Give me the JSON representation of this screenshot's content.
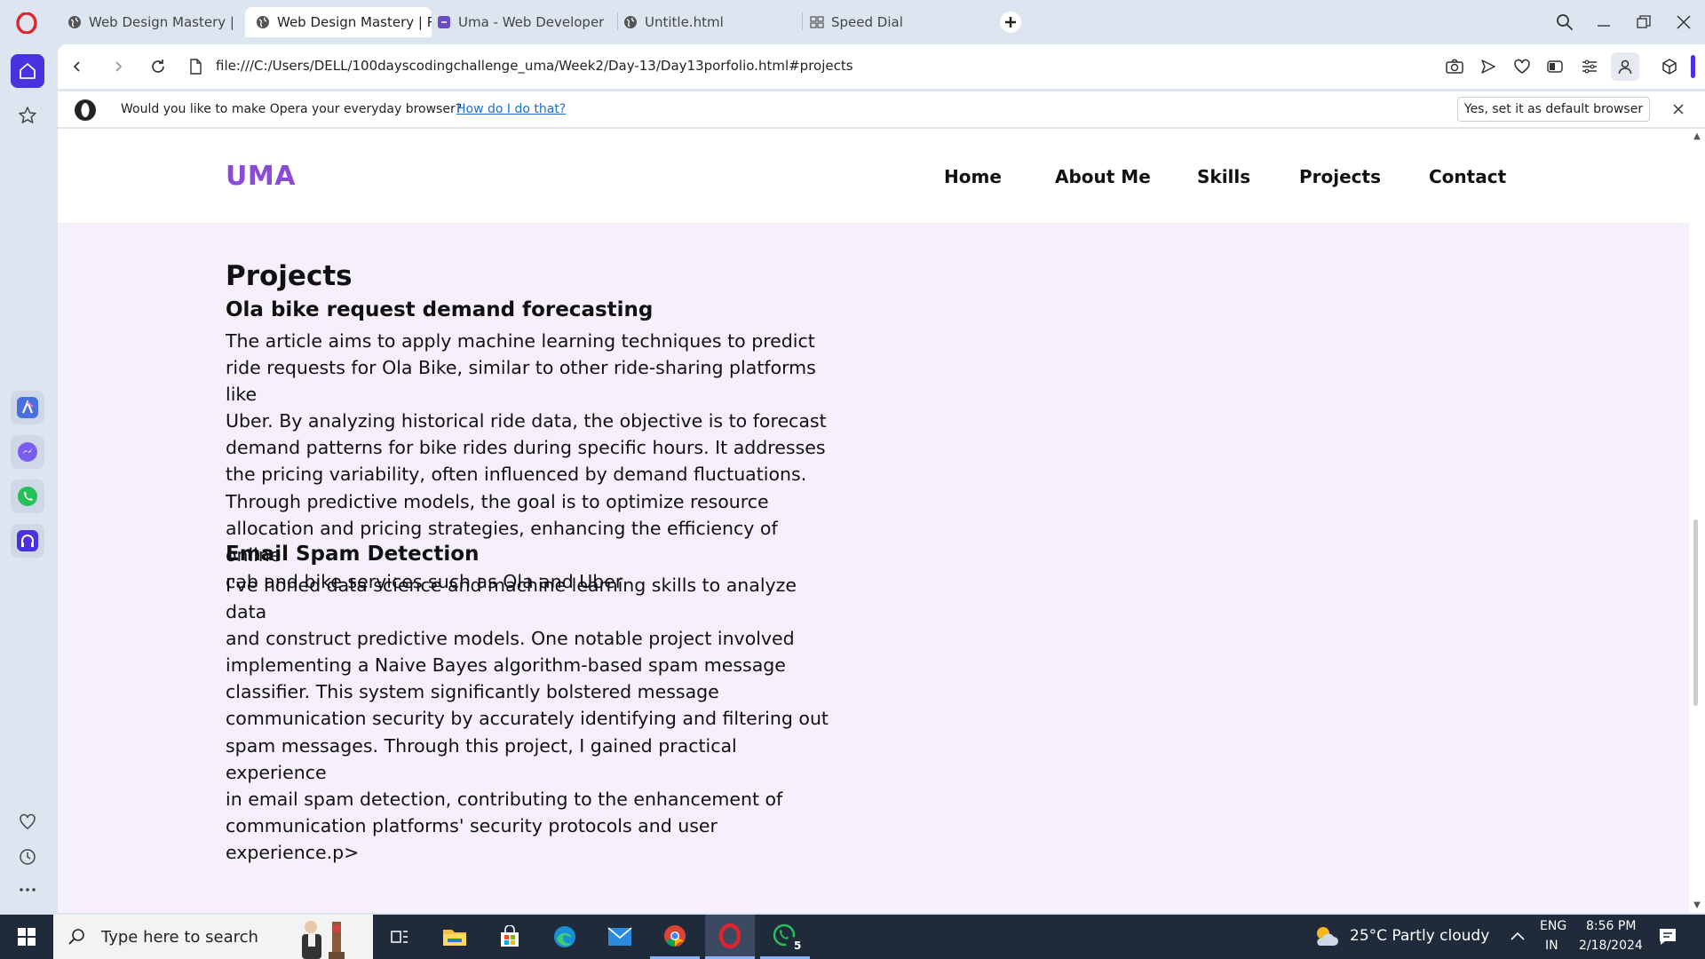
{
  "browser": {
    "tabs": [
      {
        "label": "Web Design Mastery | Res",
        "active": false
      },
      {
        "label": "Web Design Mastery | Res",
        "active": true
      },
      {
        "label": "Uma - Web Developer",
        "active": false
      },
      {
        "label": "Untitle.html",
        "active": false
      },
      {
        "label": "Speed Dial",
        "active": false
      }
    ],
    "url": "file:///C:/Users/DELL/100dayscodingchallenge_uma/Week2/Day-13/Day13porfolio.html#projects",
    "infobar": {
      "message": "Would you like to make Opera your everyday browser?",
      "link": "How do I do that?",
      "button": "Yes, set it as default browser"
    }
  },
  "site": {
    "logo": "UMA",
    "nav": [
      "Home",
      "About Me",
      "Skills",
      "Projects",
      "Contact"
    ],
    "section_title": "Projects",
    "projects": [
      {
        "title": "Ola bike request demand forecasting",
        "lines": [
          "The article aims to apply machine learning techniques to predict",
          "ride requests for Ola Bike, similar to other ride-sharing platforms like",
          "Uber. By analyzing historical ride data, the objective is to forecast",
          "demand patterns for bike rides during specific hours. It addresses",
          "the pricing variability, often influenced by demand fluctuations.",
          "Through predictive models, the goal is to optimize resource",
          "allocation and pricing strategies, enhancing the efficiency of online",
          "cab and bike services such as Ola and Uber"
        ]
      },
      {
        "title": "Email Spam Detection",
        "lines": [
          "I've honed data science and machine learning skills to analyze data",
          "and construct predictive models. One notable project involved",
          "implementing a Naive Bayes algorithm-based spam message",
          "classifier. This system significantly bolstered message",
          "communication security by accurately identifying and filtering out",
          "spam messages. Through this project, I gained practical experience",
          "in email spam detection, contributing to the enhancement of",
          "communication platforms' security protocols and user experience.p>"
        ]
      }
    ]
  },
  "taskbar": {
    "search_placeholder": "Type here to search",
    "whatsapp_badge": "5",
    "weather": "25°C  Partly cloudy",
    "lang": "ENG",
    "region": "IN",
    "time": "8:56 PM",
    "date": "2/18/2024"
  },
  "colors": {
    "accent": "#8a4bd6",
    "page_bg": "#f5f0fb",
    "chrome_bg": "#dde6f0",
    "taskbar_bg": "#1f2b3b"
  }
}
